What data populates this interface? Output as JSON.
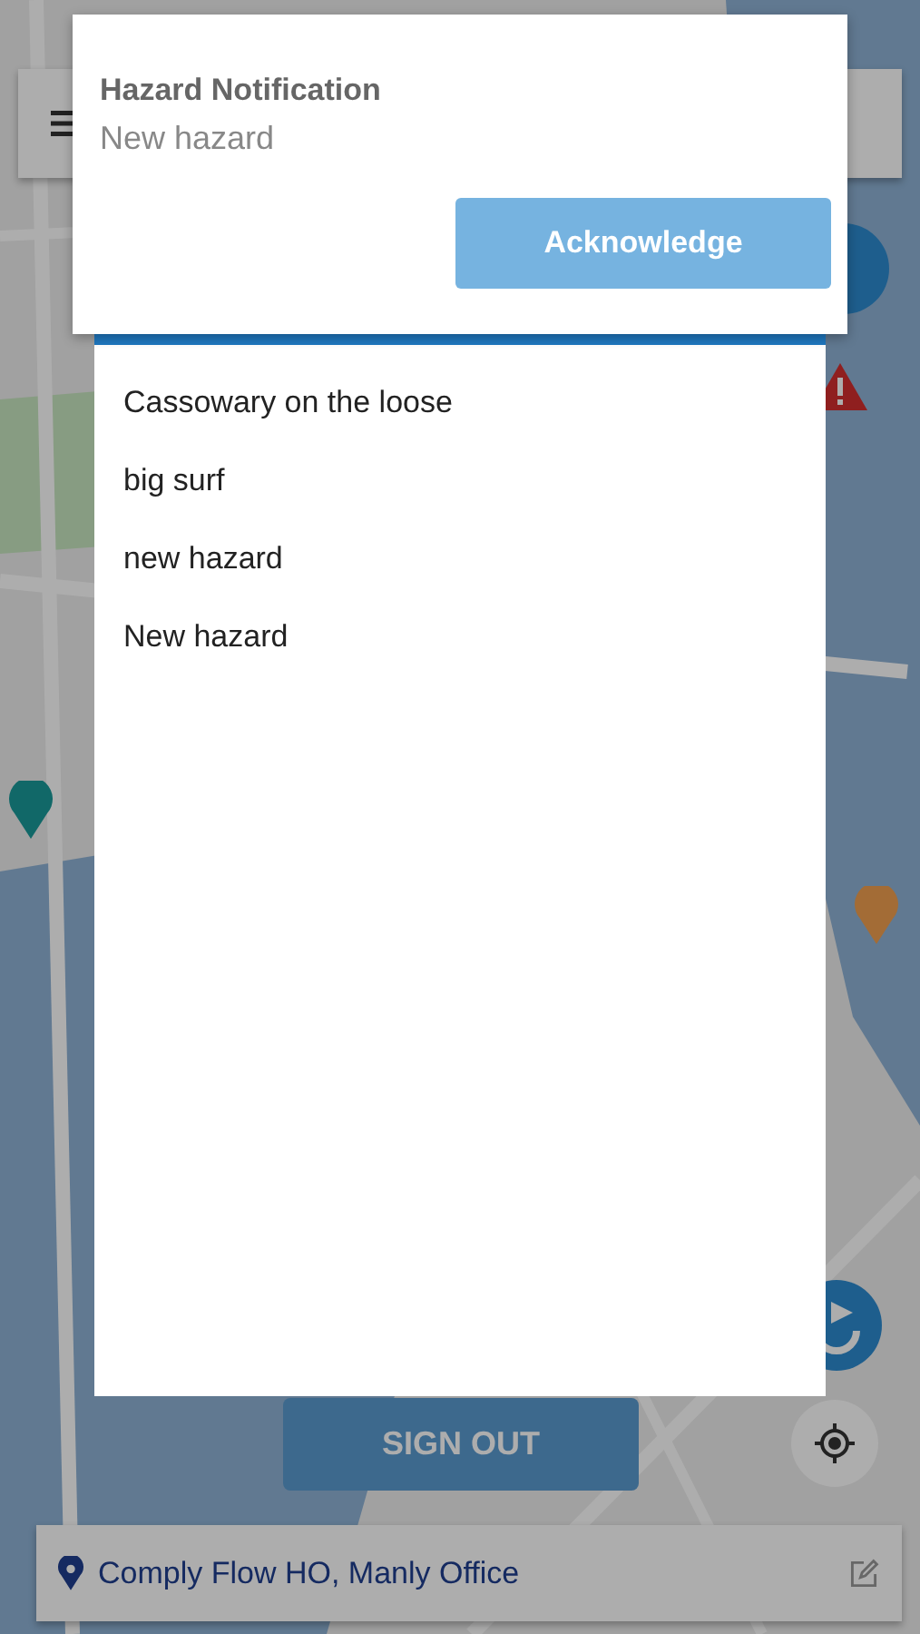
{
  "sign_out": {
    "label": "SIGN OUT"
  },
  "location_bar": {
    "name": "Comply Flow HO, Manly Office"
  },
  "notification": {
    "title": "Hazard Notification",
    "message": "New hazard",
    "button": "Acknowledge"
  },
  "hazards": [
    {
      "name": "Cassowary on the loose"
    },
    {
      "name": "big surf"
    },
    {
      "name": "new hazard"
    },
    {
      "name": "New hazard"
    }
  ]
}
